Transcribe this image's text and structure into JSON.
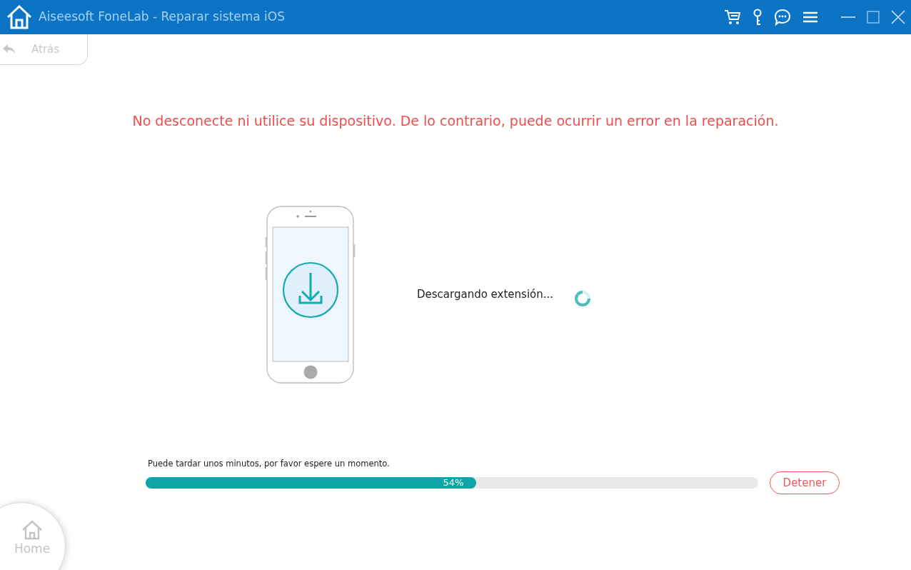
{
  "window": {
    "title": "Aiseesoft FoneLab - Reparar sistema iOS"
  },
  "back_button": {
    "label": "Atrás",
    "disabled": true
  },
  "warning": "No desconecte ni utilice su dispositivo. De lo contrario, puede ocurrir un error en la reparación.",
  "status": "Descargando extensión...",
  "progress": {
    "hint": "Puede tardar unos minutos, por favor espere un momento.",
    "level": 0.54,
    "reading": "54%"
  },
  "stop_button": {
    "label": "Detener"
  },
  "home_button": {
    "label": "Home"
  }
}
